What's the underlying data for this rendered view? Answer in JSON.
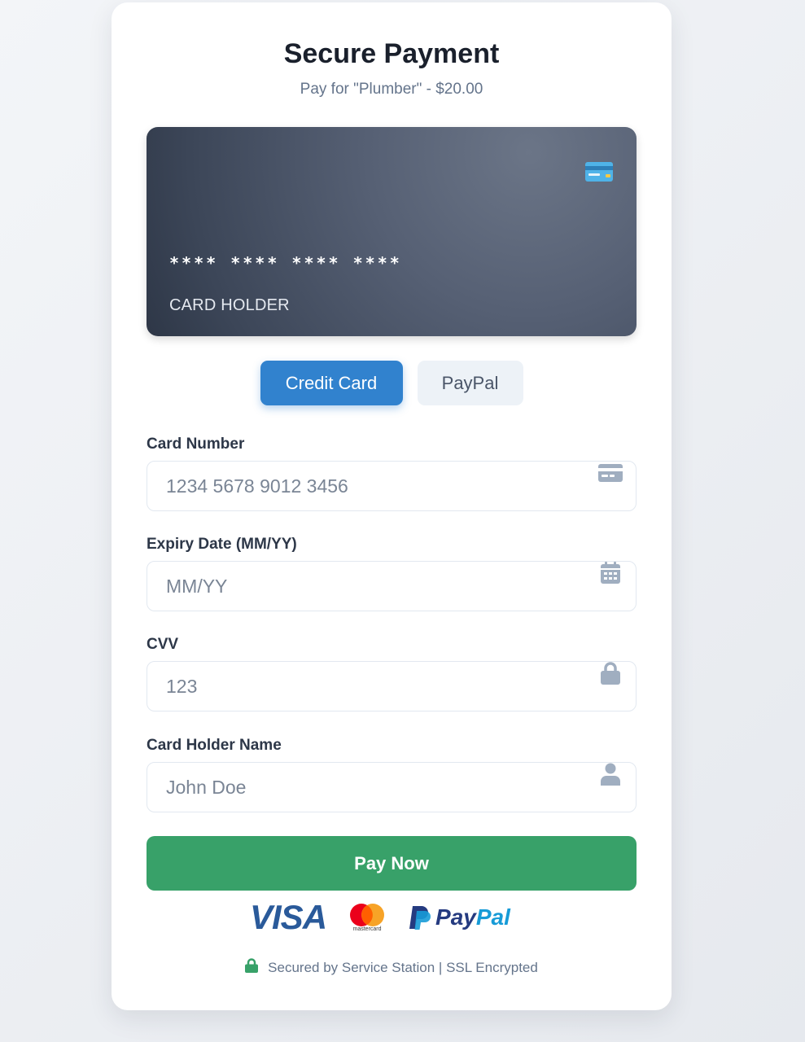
{
  "header": {
    "title": "Secure Payment",
    "subtitle": "Pay for \"Plumber\" - $20.00"
  },
  "card_preview": {
    "number": "**** **** **** ****",
    "holder": "CARD HOLDER",
    "chip_icon": "credit-card-icon"
  },
  "tabs": [
    {
      "label": "Credit Card",
      "active": true
    },
    {
      "label": "PayPal",
      "active": false
    }
  ],
  "form": {
    "card_number": {
      "label": "Card Number",
      "placeholder": "1234 5678 9012 3456",
      "value": "",
      "icon": "credit-card-icon"
    },
    "expiry": {
      "label": "Expiry Date (MM/YY)",
      "placeholder": "MM/YY",
      "value": "",
      "icon": "calendar-icon"
    },
    "cvv": {
      "label": "CVV",
      "placeholder": "123",
      "value": "",
      "icon": "lock-icon"
    },
    "holder_name": {
      "label": "Card Holder Name",
      "placeholder": "John Doe",
      "value": "",
      "icon": "user-icon"
    }
  },
  "pay_button": {
    "label": "Pay Now"
  },
  "payment_logos": {
    "visa": "VISA",
    "mastercard": "mastercard",
    "paypal_pay": "Pay",
    "paypal_pal": "Pal"
  },
  "footer": {
    "secure_text": "Secured by Service Station | SSL Encrypted",
    "icon": "lock-icon"
  },
  "colors": {
    "primary": "#3182ce",
    "success": "#38a169",
    "muted_icon": "#a0aec0",
    "title": "#1a202c"
  }
}
